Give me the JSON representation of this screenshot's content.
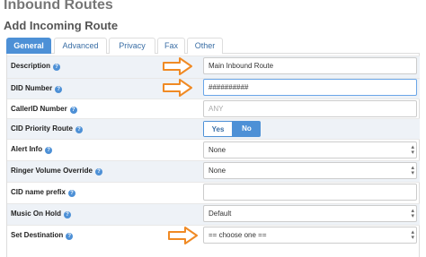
{
  "page": {
    "title": "Inbound Routes",
    "section_title": "Add Incoming Route"
  },
  "tabs": [
    {
      "label": "General"
    },
    {
      "label": "Advanced"
    },
    {
      "label": "Privacy"
    },
    {
      "label": "Fax"
    },
    {
      "label": "Other"
    }
  ],
  "form": {
    "help_symbol": "?",
    "description": {
      "label": "Description",
      "value": "Main Inbound Route"
    },
    "did_number": {
      "label": "DID Number",
      "value": "##########"
    },
    "callerid_number": {
      "label": "CallerID Number",
      "placeholder": "ANY"
    },
    "cid_priority_route": {
      "label": "CID Priority Route",
      "yes": "Yes",
      "no": "No",
      "selected": "No"
    },
    "alert_info": {
      "label": "Alert Info",
      "value": "None"
    },
    "ringer_volume_override": {
      "label": "Ringer Volume Override",
      "value": "None"
    },
    "cid_name_prefix": {
      "label": "CID name prefix",
      "value": ""
    },
    "music_on_hold": {
      "label": "Music On Hold",
      "value": "Default"
    },
    "set_destination": {
      "label": "Set Destination",
      "value": "== choose one =="
    }
  },
  "colors": {
    "accent": "#4d90d6",
    "arrow": "#f08a24",
    "alt_row": "#eef2f7"
  },
  "icons": {
    "help": "question-circle-icon",
    "arrow": "arrow-right-icon",
    "caret": "chevron-up-down-icon"
  }
}
